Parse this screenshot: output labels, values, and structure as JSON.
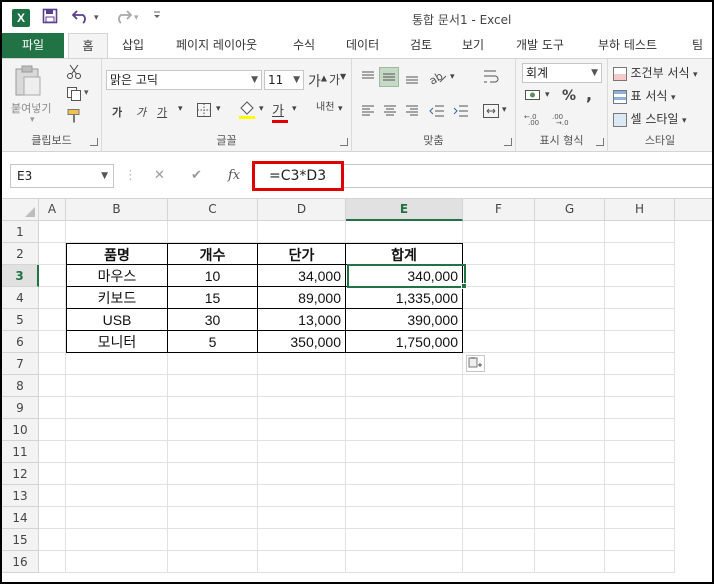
{
  "window": {
    "title": "통합 문서1 - Excel",
    "app_icon": "X"
  },
  "quick_access": {
    "save_icon": "save-icon",
    "undo_icon": "undo-icon",
    "redo_icon": "redo-icon",
    "customize_icon": "customize-qat-icon"
  },
  "tabs": {
    "file": "파일",
    "home": "홈",
    "insert": "삽입",
    "page_layout": "페이지 레이아웃",
    "formulas": "수식",
    "data": "데이터",
    "review": "검토",
    "view": "보기",
    "developer": "개발 도구",
    "load_test": "부하 테스트",
    "team": "팀"
  },
  "ribbon": {
    "clipboard": {
      "label": "클립보드",
      "paste": "붙여넣기"
    },
    "font": {
      "label": "글꼴",
      "font_name": "맑은 고딕",
      "font_size": "11",
      "bold": "가",
      "italic": "가",
      "underline": "가",
      "phonetic": "내천",
      "font_color_glyph": "가"
    },
    "alignment": {
      "label": "맞춤"
    },
    "number": {
      "label": "표시 형식",
      "format": "회계",
      "percent": "%",
      "comma": ","
    },
    "styles": {
      "label": "스타일",
      "conditional": "조건부 서식",
      "as_table": "표 서식",
      "cell_styles": "셀 스타일"
    }
  },
  "formula_bar": {
    "name_box": "E3",
    "cancel": "✕",
    "enter": "✔",
    "fx": "fx",
    "formula": "=C3*D3"
  },
  "sheet": {
    "columns": [
      "A",
      "B",
      "C",
      "D",
      "E",
      "F",
      "G",
      "H"
    ],
    "rows": [
      "1",
      "2",
      "3",
      "4",
      "5",
      "6",
      "7",
      "8",
      "9",
      "10",
      "11",
      "12",
      "13",
      "14",
      "15",
      "16"
    ],
    "selected_cell": "E3",
    "table": {
      "headers": [
        "품명",
        "개수",
        "단가",
        "합계"
      ],
      "rows": [
        [
          "마우스",
          "10",
          "34,000",
          "340,000"
        ],
        [
          "키보드",
          "15",
          "89,000",
          "1,335,000"
        ],
        [
          "USB",
          "30",
          "13,000",
          "390,000"
        ],
        [
          "모니터",
          "5",
          "350,000",
          "1,750,000"
        ]
      ]
    }
  },
  "colors": {
    "excel_green": "#217346",
    "highlight_red": "#e00000"
  }
}
